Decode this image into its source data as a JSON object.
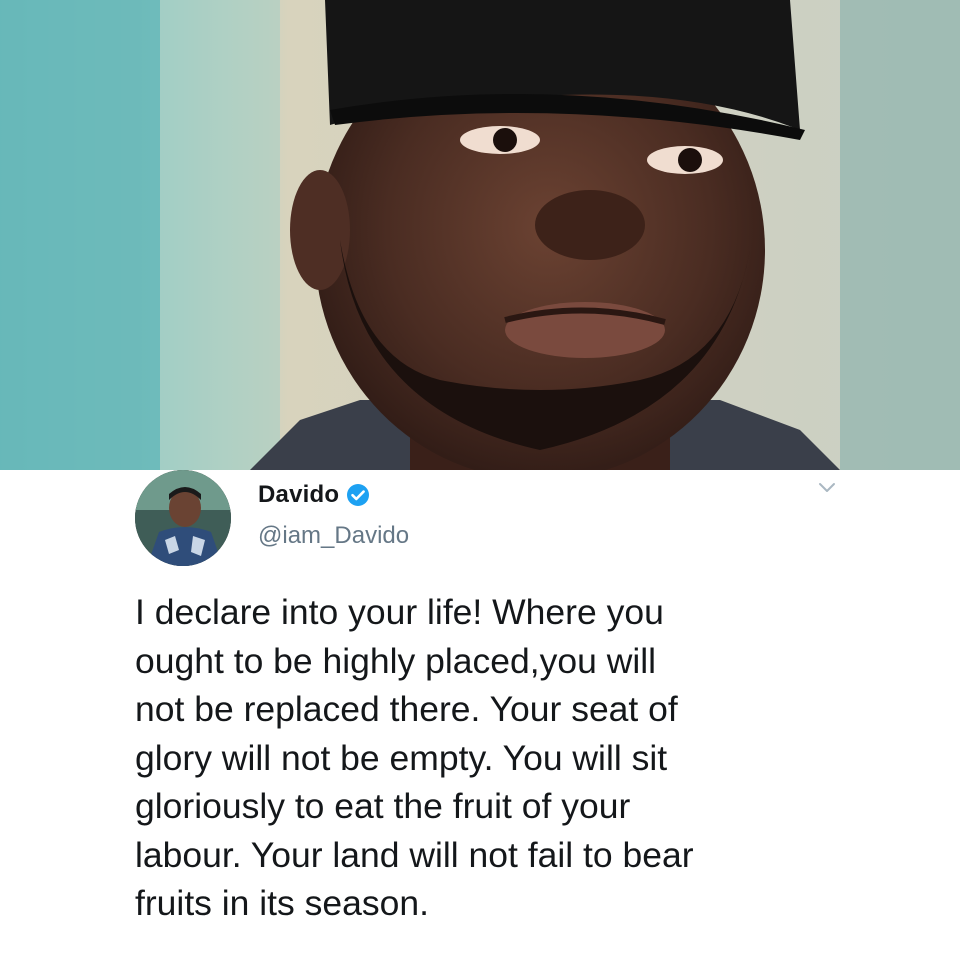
{
  "photo": {
    "icon": "portrait-photo"
  },
  "tweet": {
    "display_name": "Davido",
    "handle": "@iam_Davido",
    "verified": true,
    "text": "I declare into your life! Where you\nought to be highly placed,you will\nnot be replaced there. Your seat of\nglory will not be empty. You will sit\ngloriously to eat the fruit of your\nlabour. Your land will not fail to bear\nfruits in its season."
  },
  "colors": {
    "verified_blue": "#1da1f2",
    "handle_gray": "#657786",
    "text": "#14171a"
  },
  "icons": {
    "verified": "verified-badge-icon",
    "more": "chevron-down-icon",
    "avatar": "avatar"
  }
}
